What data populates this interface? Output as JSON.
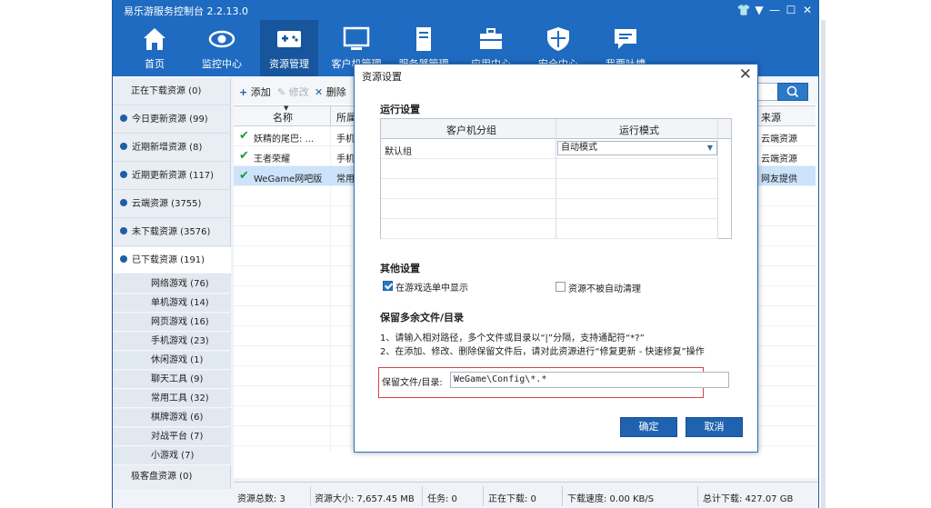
{
  "app": {
    "title": "易乐游服务控制台 2.2.13.0"
  },
  "toolbar": {
    "items": [
      {
        "label": "首页"
      },
      {
        "label": "监控中心"
      },
      {
        "label": "资源管理"
      },
      {
        "label": "客户机管理"
      },
      {
        "label": "服务器管理"
      },
      {
        "label": "应用中心"
      },
      {
        "label": "安全中心"
      },
      {
        "label": "我要吐槽"
      }
    ]
  },
  "sidebar": {
    "items": [
      {
        "label": "正在下载资源 (0)"
      },
      {
        "label": "今日更新资源 (99)"
      },
      {
        "label": "近期新增资源 (8)"
      },
      {
        "label": "近期更新资源 (117)"
      },
      {
        "label": "云端资源 (3755)"
      },
      {
        "label": "未下载资源 (3576)"
      },
      {
        "label": "已下载资源 (191)"
      },
      {
        "label": "极客盘资源 (0)"
      }
    ],
    "subitems": [
      {
        "label": "网络游戏 (76)"
      },
      {
        "label": "单机游戏 (14)"
      },
      {
        "label": "网页游戏 (16)"
      },
      {
        "label": "手机游戏 (23)"
      },
      {
        "label": "休闲游戏 (1)"
      },
      {
        "label": "聊天工具 (9)"
      },
      {
        "label": "常用工具 (32)"
      },
      {
        "label": "棋牌游戏 (6)"
      },
      {
        "label": "对战平台 (7)"
      },
      {
        "label": "小游戏 (7)"
      }
    ]
  },
  "actions": {
    "add": "添加",
    "edit": "修改",
    "delete": "删除"
  },
  "grid": {
    "columns": [
      "名称",
      "所属",
      "来源"
    ],
    "rows": [
      {
        "name": "妖精的尾巴: ...",
        "category": "手机",
        "source": "云端资源"
      },
      {
        "name": "王者荣耀",
        "category": "手机",
        "source": "云端资源"
      },
      {
        "name": "WeGame网吧版",
        "category": "常用",
        "source": "网友提供"
      }
    ]
  },
  "status": {
    "total_count": "资源总数: 3",
    "total_size": "资源大小: 7,657.45 MB",
    "tasks": "任务: 0",
    "downloading": "正在下载: 0",
    "speed": "下载速度: 0.00 KB/S",
    "total_download": "总计下载: 427.07 GB"
  },
  "dialog": {
    "title": "资源设置",
    "run_settings_title": "运行设置",
    "table_headers": [
      "客户机分组",
      "运行模式"
    ],
    "row_group": "默认组",
    "row_mode": "自动模式",
    "other_settings_title": "其他设置",
    "option_show_in_select": "在游戏选单中显示",
    "option_show_in_select_checked": true,
    "option_no_auto_clean": "资源不被自动清理",
    "option_no_auto_clean_checked": false,
    "keep_title": "保留多余文件/目录",
    "note1": "1、请输入相对路径，多个文件或目录以“|”分隔，支持通配符“*?”",
    "note2": "2、在添加、修改、删除保留文件后，请对此资源进行“修复更新 - 快速修复”操作",
    "keep_label": "保留文件/目录:",
    "keep_value": "WeGame\\Config\\*.*",
    "ok_label": "确定",
    "cancel_label": "取消"
  },
  "colors": {
    "accent": "#1f6bc1",
    "active_tab": "#17559c",
    "highlight": "#d64545"
  }
}
